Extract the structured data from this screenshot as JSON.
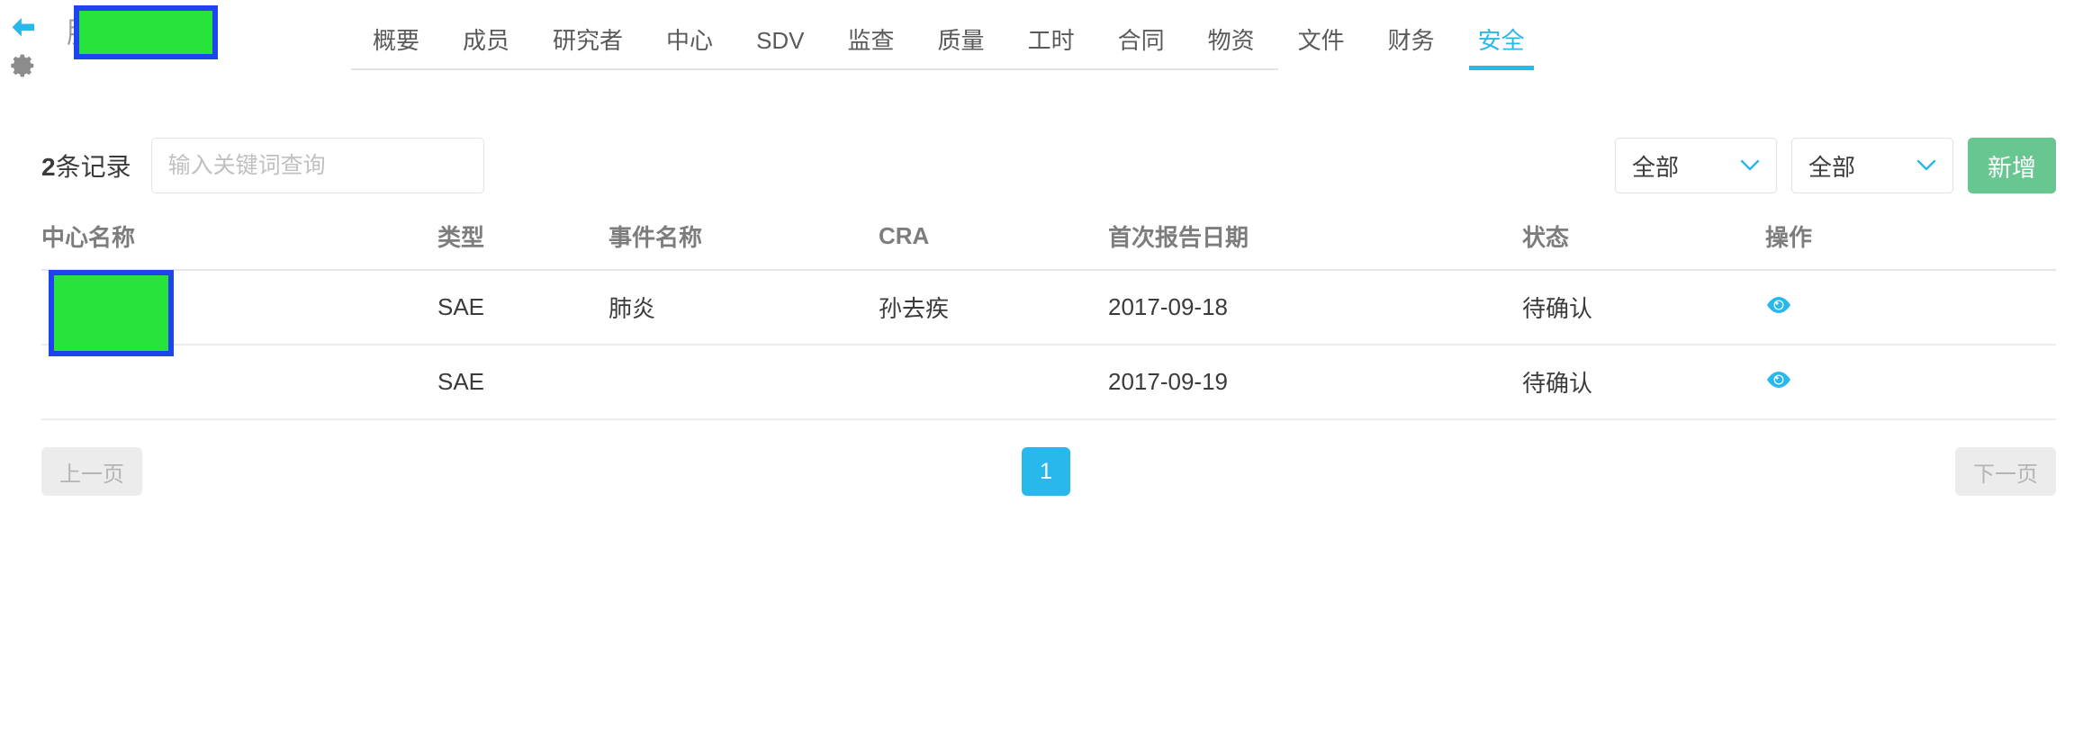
{
  "header": {
    "back_icon": "back-arrow-icon",
    "gear_icon": "gear-icon",
    "study_title": "胶囊",
    "tabs": [
      {
        "label": "概要",
        "active": false
      },
      {
        "label": "成员",
        "active": false
      },
      {
        "label": "研究者",
        "active": false
      },
      {
        "label": "中心",
        "active": false
      },
      {
        "label": "SDV",
        "active": false
      },
      {
        "label": "监查",
        "active": false
      },
      {
        "label": "质量",
        "active": false
      },
      {
        "label": "工时",
        "active": false
      },
      {
        "label": "合同",
        "active": false
      },
      {
        "label": "物资",
        "active": false
      },
      {
        "label": "文件",
        "active": false
      },
      {
        "label": "财务",
        "active": false
      },
      {
        "label": "安全",
        "active": true
      }
    ]
  },
  "toolbar": {
    "record_count_number": "2",
    "record_count_suffix": "条记录",
    "search_placeholder": "输入关键词查询",
    "search_value": "",
    "filter_one": "全部",
    "filter_two": "全部",
    "add_label": "新增"
  },
  "table": {
    "columns": [
      "中心名称",
      "类型",
      "事件名称",
      "CRA",
      "首次报告日期",
      "状态",
      "操作"
    ],
    "rows": [
      {
        "center": "",
        "type": "SAE",
        "event": "肺炎",
        "cra": "孙去疾",
        "first_report_date": "2017-09-18",
        "status": "待确认",
        "action_icon": "eye-icon"
      },
      {
        "center": "",
        "type": "SAE",
        "event": "",
        "cra": "",
        "first_report_date": "2017-09-19",
        "status": "待确认",
        "action_icon": "eye-icon"
      }
    ]
  },
  "pagination": {
    "prev_label": "上一页",
    "current_page": "1",
    "next_label": "下一页"
  },
  "colors": {
    "accent_cyan": "#29b8ec",
    "add_green": "#68c690",
    "redaction_fill": "#27e33c",
    "redaction_border": "#1d44ef",
    "text_primary": "#3b3b3b",
    "text_muted": "#7d7d7d"
  }
}
